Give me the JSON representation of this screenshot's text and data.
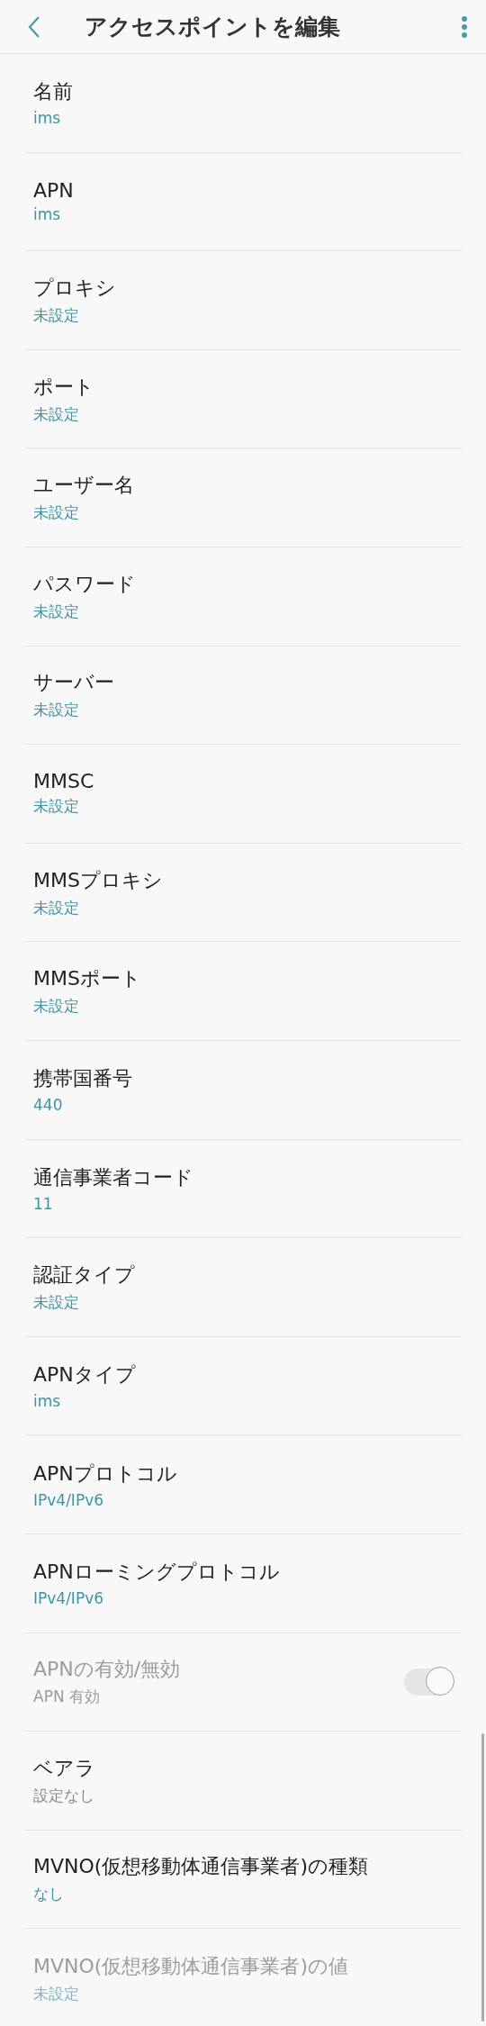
{
  "header": {
    "title": "アクセスポイントを編集"
  },
  "settings": [
    {
      "kind": "value",
      "label": "名前",
      "value": "ims",
      "disabled": false
    },
    {
      "kind": "value",
      "label": "APN",
      "value": "ims",
      "disabled": false
    },
    {
      "kind": "value",
      "label": "プロキシ",
      "value": "未設定",
      "disabled": false
    },
    {
      "kind": "value",
      "label": "ポート",
      "value": "未設定",
      "disabled": false
    },
    {
      "kind": "value",
      "label": "ユーザー名",
      "value": "未設定",
      "disabled": false
    },
    {
      "kind": "value",
      "label": "パスワード",
      "value": "未設定",
      "disabled": false
    },
    {
      "kind": "value",
      "label": "サーバー",
      "value": "未設定",
      "disabled": false
    },
    {
      "kind": "value",
      "label": "MMSC",
      "value": "未設定",
      "disabled": false
    },
    {
      "kind": "value",
      "label": "MMSプロキシ",
      "value": "未設定",
      "disabled": false
    },
    {
      "kind": "value",
      "label": "MMSポート",
      "value": "未設定",
      "disabled": false
    },
    {
      "kind": "value",
      "label": "携帯国番号",
      "value": "440",
      "disabled": false
    },
    {
      "kind": "value",
      "label": "通信事業者コード",
      "value": "11",
      "disabled": false
    },
    {
      "kind": "value",
      "label": "認証タイプ",
      "value": "未設定",
      "disabled": false
    },
    {
      "kind": "value",
      "label": "APNタイプ",
      "value": "ims",
      "disabled": false
    },
    {
      "kind": "value",
      "label": "APNプロトコル",
      "value": "IPv4/IPv6",
      "disabled": false
    },
    {
      "kind": "value",
      "label": "APNローミングプロトコル",
      "value": "IPv4/IPv6",
      "disabled": false
    },
    {
      "kind": "switch",
      "label": "APNの有効/無効",
      "value": "APN 有効",
      "disabled": true,
      "on": true
    },
    {
      "kind": "note",
      "label": "ベアラ",
      "value": "設定なし",
      "disabled": false
    },
    {
      "kind": "value",
      "label": "MVNO(仮想移動体通信事業者)の種類",
      "value": "なし",
      "disabled": false
    },
    {
      "kind": "value",
      "label": "MVNO(仮想移動体通信事業者)の値",
      "value": "未設定",
      "disabled": true
    }
  ]
}
